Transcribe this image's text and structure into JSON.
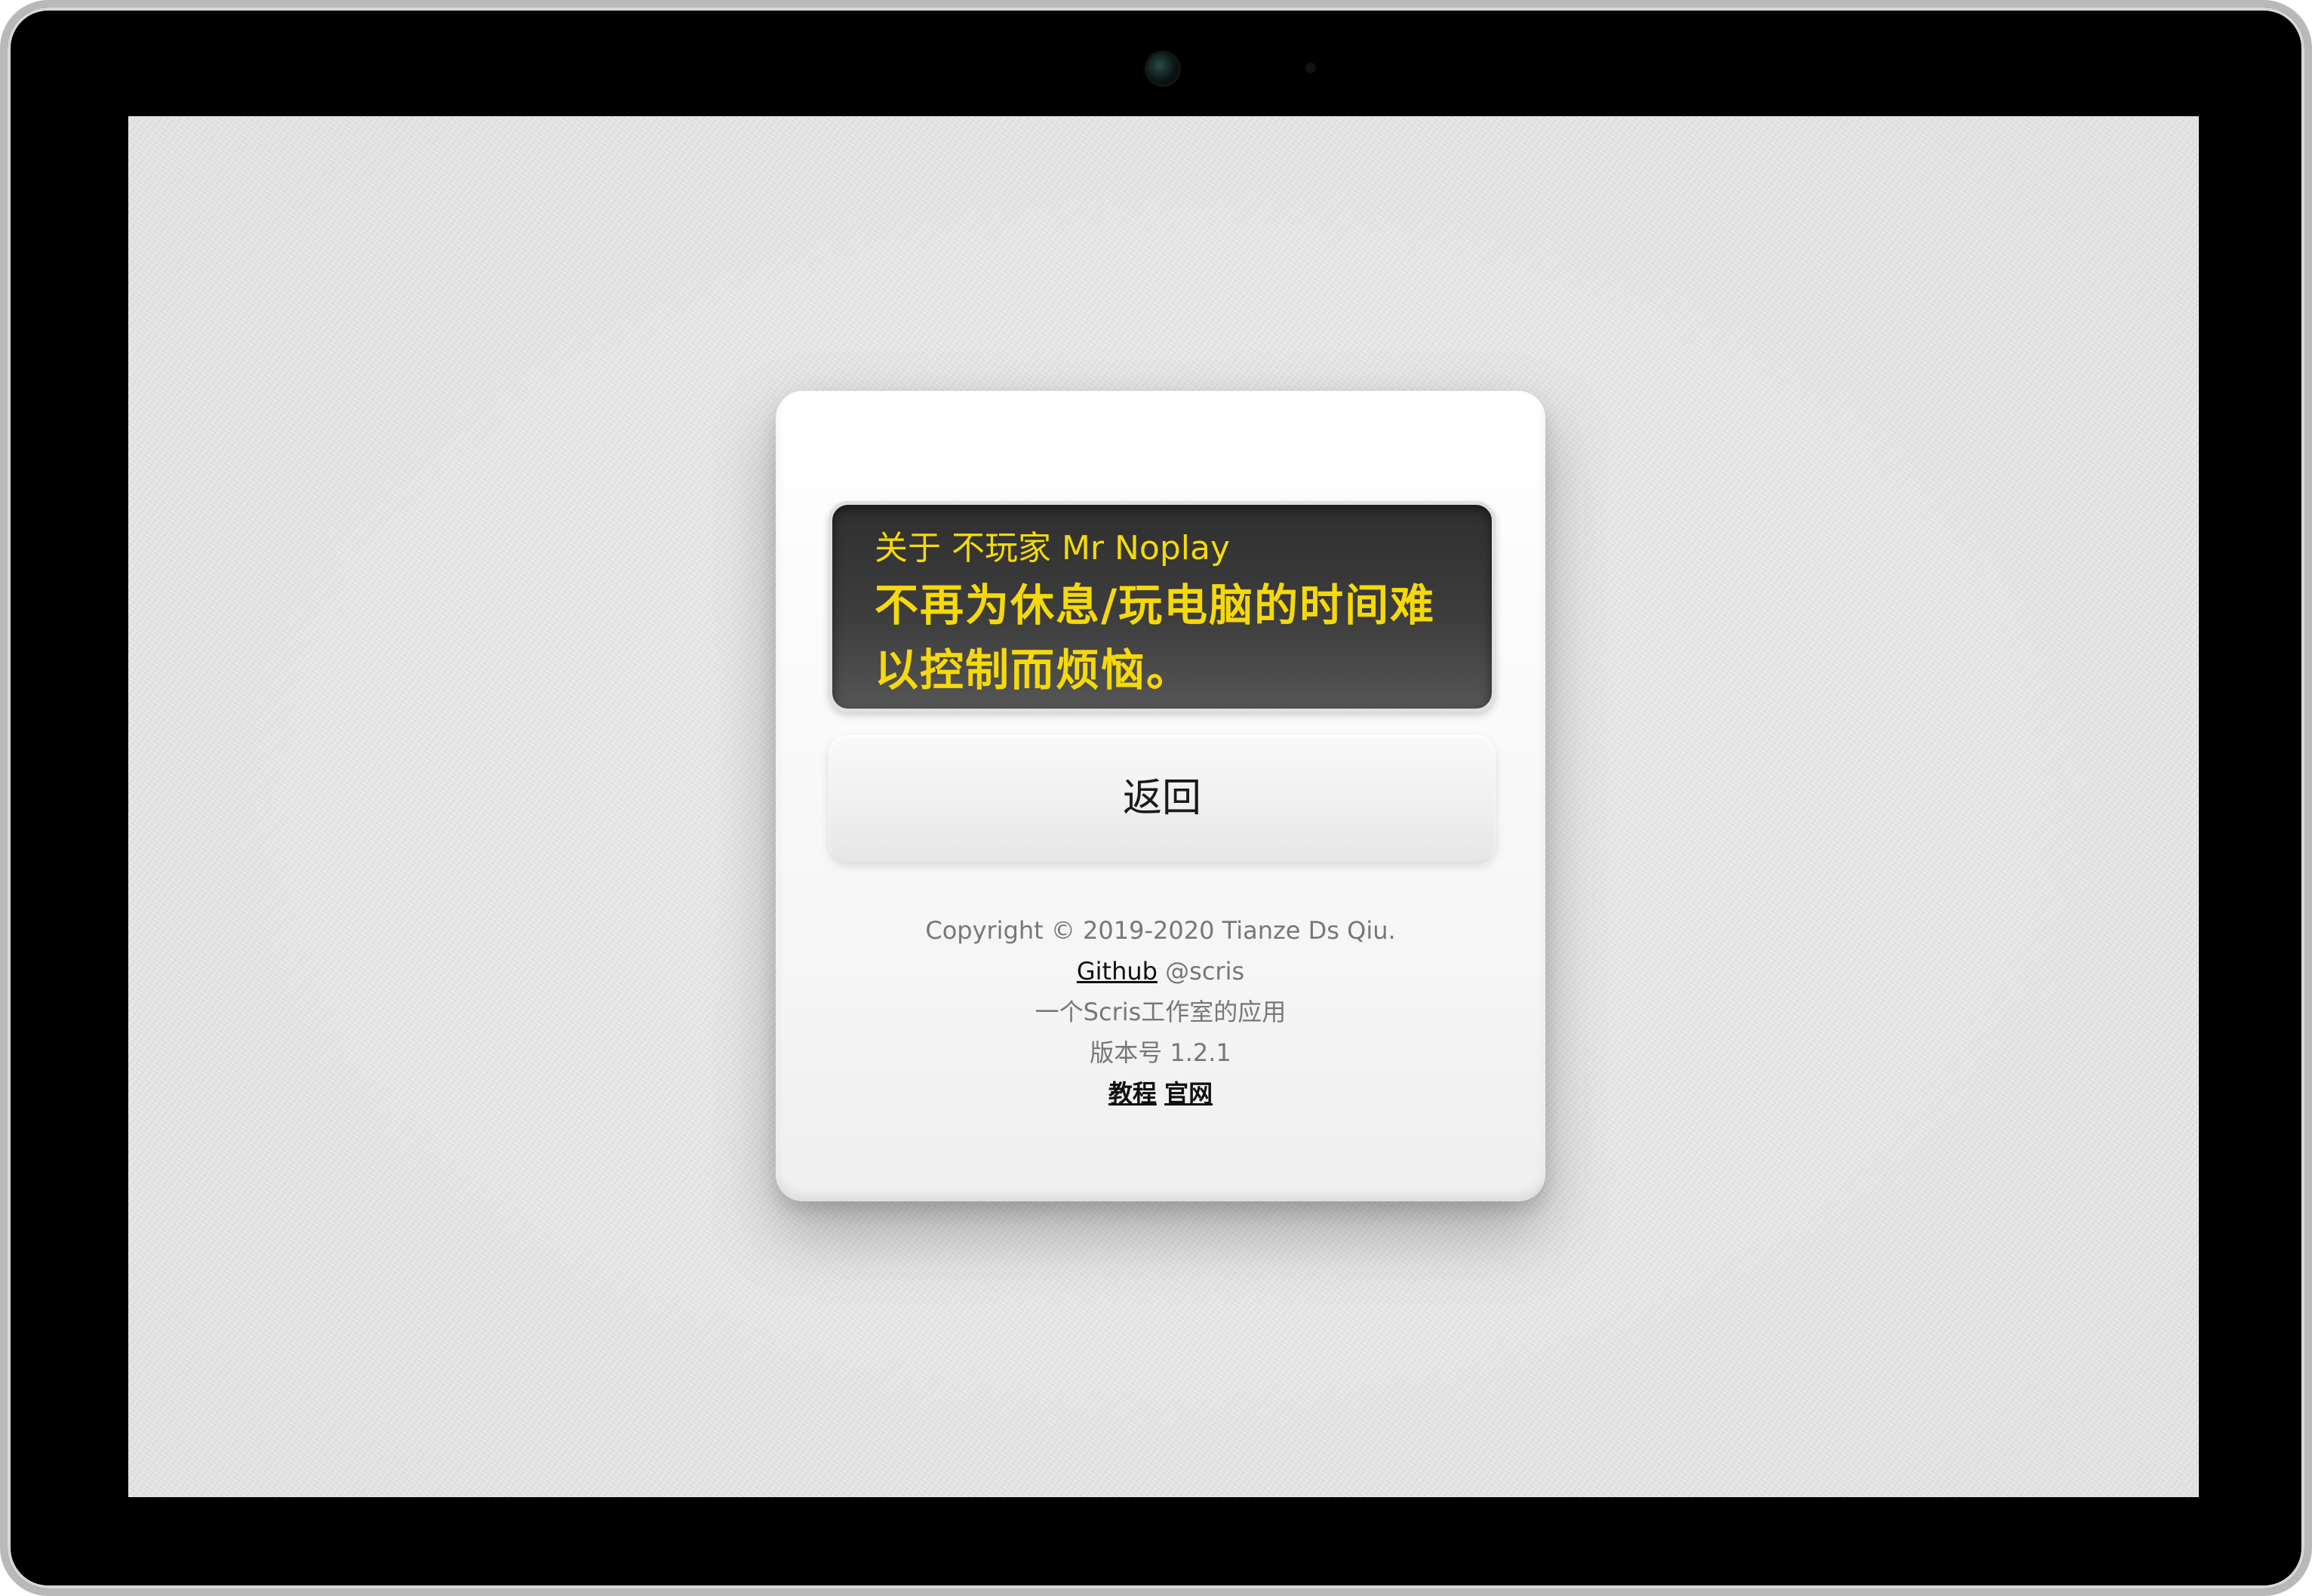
{
  "about": {
    "subtitle": "关于 不玩家 Mr Noplay",
    "title": "不再为休息/玩电脑的时间难以控制而烦恼。",
    "back_button": "返回"
  },
  "footer": {
    "copyright": "Copyright © 2019-2020 Tianze Ds Qiu.",
    "github_link": "Github",
    "github_handle": "@scris",
    "studio": "一个Scris工作室的应用",
    "version": "版本号 1.2.1",
    "tutorial_link": "教程",
    "website_link": "官网"
  },
  "colors": {
    "banner_text": "#f5d90a",
    "banner_bg": "#3a3a3a",
    "page_bg": "#e9e9e9"
  }
}
